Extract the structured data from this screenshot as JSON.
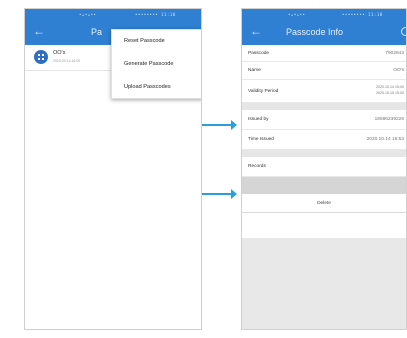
{
  "left_screen": {
    "status_text": "•▴•▴••",
    "status_right": "•••••••• 11:10",
    "title": "Pa",
    "list": [
      {
        "name": "OO's",
        "date": "2020.03.14.16:00"
      }
    ],
    "menu": [
      "Reset Passcode",
      "Generate Passcode",
      "Upload Passcodes"
    ]
  },
  "right_screen": {
    "status_text": "•▴•▴••",
    "status_right": "•••••••• 11:10",
    "title": "Passcode Info",
    "rows": {
      "passcode": {
        "label": "Passcode",
        "value": "7902843"
      },
      "name": {
        "label": "Name",
        "value": "OO's"
      },
      "validity": {
        "label": "Validity Period",
        "value_1": "2020.10.14 15:00",
        "value_2": "2020.10.15 15:00"
      },
      "issued_by": {
        "label": "Issued by",
        "value": "18596239226"
      },
      "time_issued": {
        "label": "Time Issued",
        "value": "2020.10.14 16:53"
      },
      "records": {
        "label": "Records"
      }
    },
    "delete_label": "Delete"
  },
  "colors": {
    "header_blue": "#2f80d3",
    "arrow_blue": "#2a9fd8"
  }
}
